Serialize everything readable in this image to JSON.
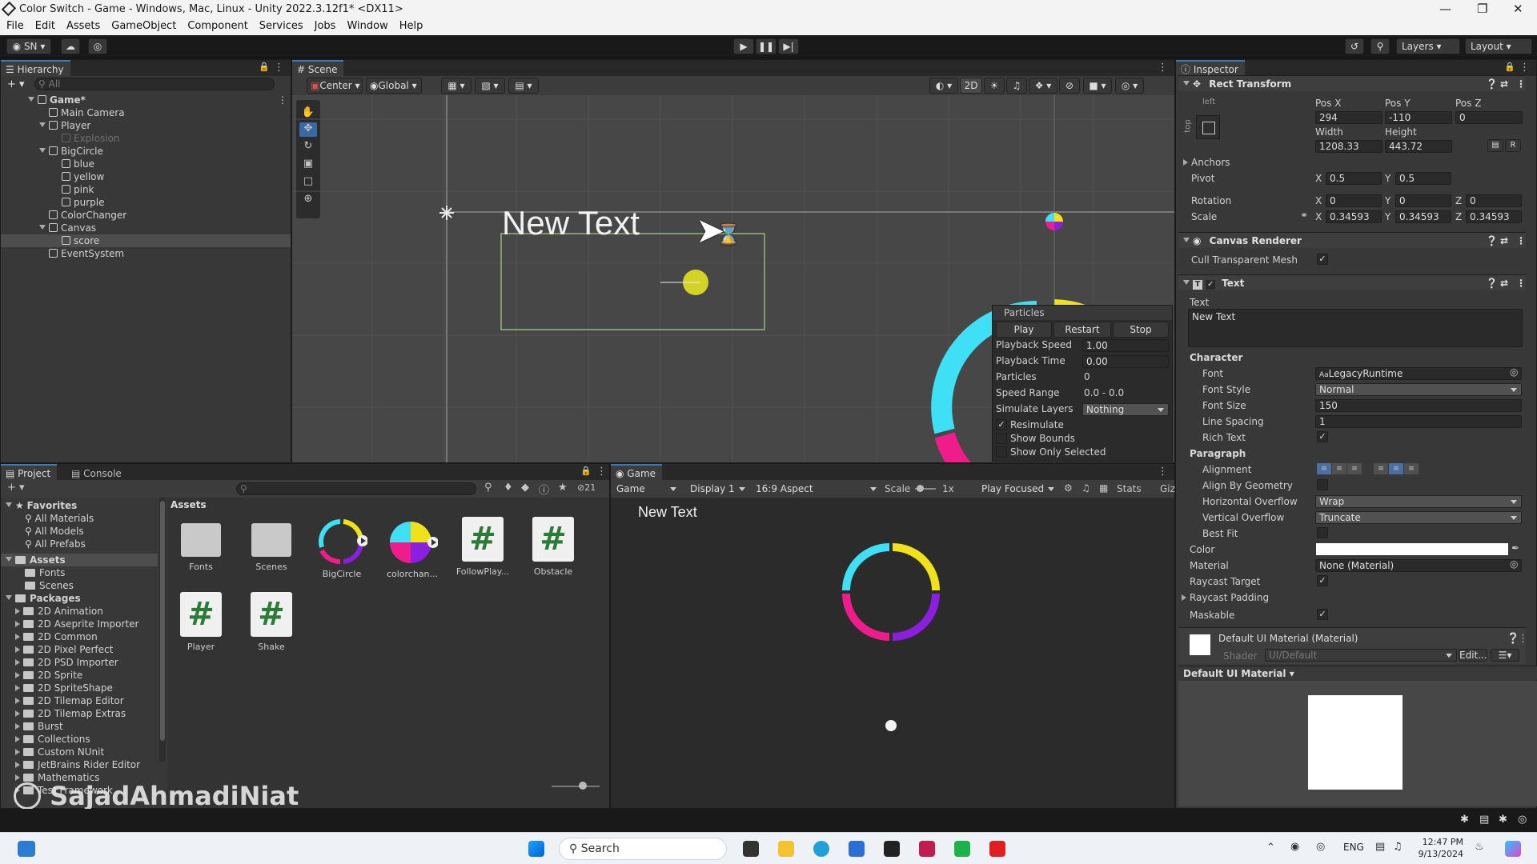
{
  "window": {
    "title": "Color Switch - Game - Windows, Mac, Linux - Unity 2022.3.12f1* <DX11>"
  },
  "menu": [
    "File",
    "Edit",
    "Assets",
    "GameObject",
    "Component",
    "Services",
    "Jobs",
    "Window",
    "Help"
  ],
  "toolbar": {
    "account": "SN",
    "layers": "Layers",
    "layout": "Layout"
  },
  "hierarchy": {
    "tab": "Hierarchy",
    "search_placeholder": "All",
    "items": [
      {
        "label": "Game*"
      },
      {
        "label": "Main Camera"
      },
      {
        "label": "Player"
      },
      {
        "label": "Explosion"
      },
      {
        "label": "BigCircle"
      },
      {
        "label": "blue"
      },
      {
        "label": "yellow"
      },
      {
        "label": "pink"
      },
      {
        "label": "purple"
      },
      {
        "label": "ColorChanger"
      },
      {
        "label": "Canvas"
      },
      {
        "label": "score"
      },
      {
        "label": "EventSystem"
      }
    ]
  },
  "scene": {
    "tab": "Scene",
    "pivot": "Center",
    "space": "Global",
    "mode2d": "2D",
    "text": "New Text",
    "particles": {
      "title": "Particles",
      "buttons": [
        "Play",
        "Restart",
        "Stop"
      ],
      "rows": [
        {
          "label": "Playback Speed",
          "value": "1.00"
        },
        {
          "label": "Playback Time",
          "value": "0.00"
        },
        {
          "label": "Particles",
          "value": "0"
        },
        {
          "label": "Speed Range",
          "value": "0.0 - 0.0"
        },
        {
          "label": "Simulate Layers",
          "value": "Nothing"
        }
      ],
      "checks": [
        "Resimulate",
        "Show Bounds",
        "Show Only Selected"
      ]
    },
    "ring_colors": [
      "#3fe0f5",
      "#f0e21a",
      "#8a1fe0",
      "#f01c8c"
    ]
  },
  "inspector": {
    "tab": "Inspector",
    "rect": {
      "title": "Rect Transform",
      "anchor_left": "left",
      "anchor_top": "top",
      "posx_label": "Pos X",
      "posy_label": "Pos Y",
      "posz_label": "Pos Z",
      "posx": "294",
      "posy": "-110",
      "posz": "0",
      "width_label": "Width",
      "height_label": "Height",
      "width": "1208.33",
      "height": "443.72",
      "anchors": "Anchors",
      "pivot": "Pivot",
      "pivot_x": "0.5",
      "pivot_y": "0.5",
      "rotation": "Rotation",
      "rot_x": "0",
      "rot_y": "0",
      "rot_z": "0",
      "scale": "Scale",
      "scale_x": "0.34593",
      "scale_y": "0.34593",
      "scale_z": "0.34593"
    },
    "canvas_renderer": {
      "title": "Canvas Renderer",
      "cull": "Cull Transparent Mesh"
    },
    "text": {
      "title": "Text",
      "text_label": "Text",
      "value": "New Text",
      "character": "Character",
      "font_label": "Font",
      "font": "LegacyRuntime",
      "font_style_label": "Font Style",
      "font_style": "Normal",
      "font_size_label": "Font Size",
      "font_size": "150",
      "line_spacing_label": "Line Spacing",
      "line_spacing": "1",
      "rich_text": "Rich Text",
      "paragraph": "Paragraph",
      "alignment": "Alignment",
      "align_geometry": "Align By Geometry",
      "h_overflow_label": "Horizontal Overflow",
      "h_overflow": "Wrap",
      "v_overflow_label": "Vertical Overflow",
      "v_overflow": "Truncate",
      "best_fit": "Best Fit",
      "color_label": "Color",
      "material_label": "Material",
      "material": "None (Material)",
      "raycast_target": "Raycast Target",
      "raycast_padding": "Raycast Padding",
      "maskable": "Maskable"
    },
    "material": {
      "title": "Default UI Material (Material)",
      "shader_label": "Shader",
      "shader": "UI/Default",
      "edit": "Edit...",
      "preview_label": "Default UI Material"
    }
  },
  "project": {
    "tabs": [
      "Project",
      "Console"
    ],
    "count": "21",
    "favorites": {
      "title": "Favorites",
      "items": [
        "All Materials",
        "All Models",
        "All Prefabs"
      ]
    },
    "assets_tree": {
      "title": "Assets",
      "items": [
        "Fonts",
        "Scenes"
      ]
    },
    "packages": {
      "title": "Packages",
      "items": [
        "2D Animation",
        "2D Aseprite Importer",
        "2D Common",
        "2D Pixel Perfect",
        "2D PSD Importer",
        "2D Sprite",
        "2D SpriteShape",
        "2D Tilemap Editor",
        "2D Tilemap Extras",
        "Burst",
        "Collections",
        "Custom NUnit",
        "JetBrains Rider Editor",
        "Mathematics",
        "Test Framework"
      ]
    },
    "breadcrumb": "Assets",
    "assets": [
      {
        "name": "Fonts",
        "kind": "folder"
      },
      {
        "name": "Scenes",
        "kind": "folder"
      },
      {
        "name": "BigCircle",
        "kind": "prefab"
      },
      {
        "name": "colorchan...",
        "kind": "prefab"
      },
      {
        "name": "FollowPlay...",
        "kind": "script"
      },
      {
        "name": "Obstacle",
        "kind": "script"
      },
      {
        "name": "Player",
        "kind": "script"
      },
      {
        "name": "Shake",
        "kind": "script"
      }
    ]
  },
  "game": {
    "tab": "Game",
    "view": "Game",
    "display": "Display 1",
    "aspect": "16:9 Aspect",
    "scale_label": "Scale",
    "scale_value": "1x",
    "play_focused": "Play Focused",
    "stats": "Stats",
    "gizmos": "Giz",
    "text": "New Text"
  },
  "watermark": "SajadAhmadiNiat",
  "taskbar": {
    "search": "Search",
    "lang": "ENG",
    "time": "12:47 PM",
    "date": "9/13/2024"
  }
}
